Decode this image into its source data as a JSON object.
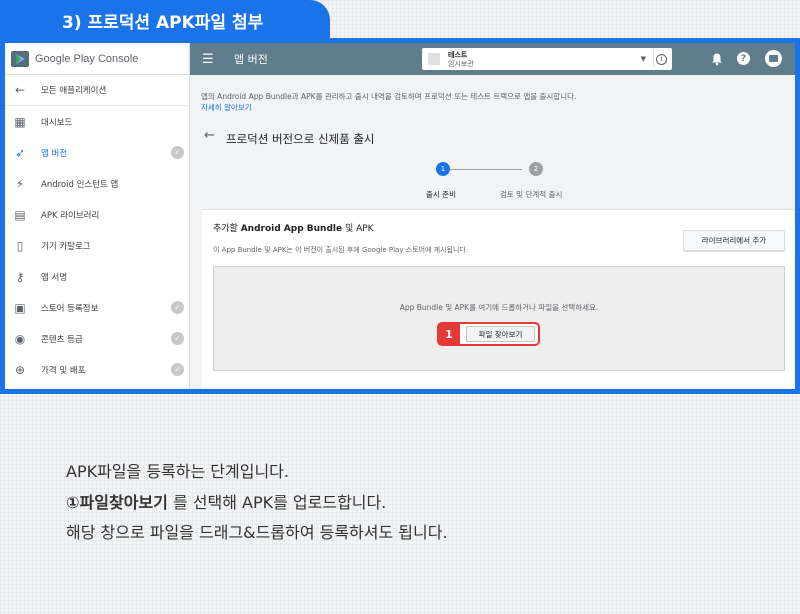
{
  "step_tab": {
    "title": "3) 프로덕션 APK파일 첨부"
  },
  "sidebar": {
    "logo_text": "Google Play Console",
    "back_label": "모든 애플리케이션",
    "items": [
      {
        "label": "대시보드",
        "icon": "dashboard-icon",
        "checked": false,
        "active": false
      },
      {
        "label": "앱 버전",
        "icon": "rocket-icon",
        "checked": true,
        "active": true
      },
      {
        "label": "Android 인스턴트 앱",
        "icon": "instant-app-icon",
        "checked": false,
        "active": false
      },
      {
        "label": "APK 라이브러리",
        "icon": "library-icon",
        "checked": false,
        "active": false
      },
      {
        "label": "기기 카탈로그",
        "icon": "device-icon",
        "checked": false,
        "active": false
      },
      {
        "label": "앱 서명",
        "icon": "key-icon",
        "checked": false,
        "active": false
      },
      {
        "label": "스토어 등록정보",
        "icon": "store-icon",
        "checked": true,
        "active": false
      },
      {
        "label": "콘텐츠 등급",
        "icon": "rating-icon",
        "checked": true,
        "active": false
      },
      {
        "label": "가격 및 배포",
        "icon": "globe-icon",
        "checked": true,
        "active": false
      }
    ]
  },
  "topbar": {
    "title": "앱 버전",
    "app_name": "테스트",
    "app_sub": "임시보관"
  },
  "main": {
    "description": "앱의 Android App Bundle과 APK를 관리하고 출시 내역을 검토하며 프로덕션 또는 테스트 트랙으로 앱을 출시합니다.",
    "learn_more": "자세히 알아보기",
    "page_title": "프로덕션 버전으로 신제품 출시",
    "steps": [
      {
        "number": "1",
        "label": "출시 준비"
      },
      {
        "number": "2",
        "label": "검토 및 단계적 출시"
      }
    ],
    "card": {
      "title_prefix": "추가할 ",
      "title_bold": "Android App Bundle",
      "title_suffix": " 및 APK",
      "subtitle": "이 App Bundle 및 APK는 이 버전이 출시된 후에 Google Play 스토어에 게시됩니다.",
      "library_button": "라이브러리에서 추가",
      "drop_text": "App Bundle 및 APK를 여기에 드롭하거나 파일을 선택하세요.",
      "badge": "1",
      "browse_button": "파일 찾아보기"
    }
  },
  "caption": {
    "line1": "APK파일을 등록하는 단계입니다.",
    "line2_bold": "①파일찾아보기",
    "line2_rest": " 를 선택해 APK를 업로드합니다.",
    "line3": "해당 창으로 파일을 드래그&드롭하여 등록하셔도 됩니다."
  },
  "colors": {
    "accent": "#1a73e8",
    "header": "#607d8b",
    "highlight": "#e53935"
  }
}
